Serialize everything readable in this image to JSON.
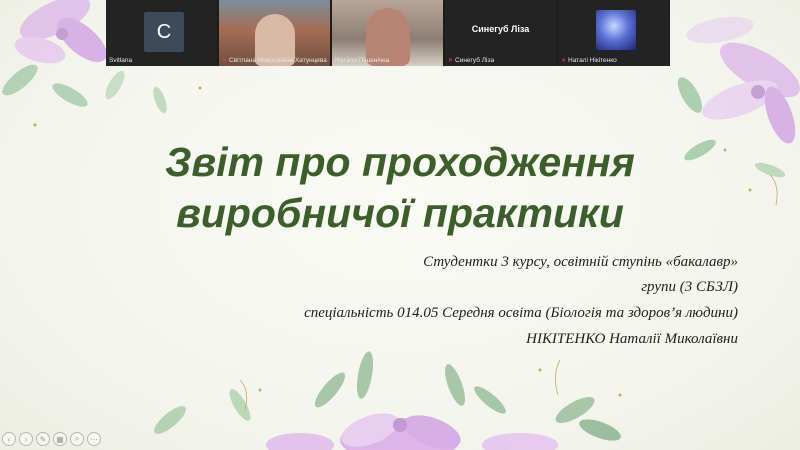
{
  "slide": {
    "title_line1": "Звіт про проходження",
    "title_line2": "виробничої практики",
    "subtitle_lines": [
      "Студентки 3 курсу, освітній ступінь «бакалавр»",
      "групи (3 СБЗЛ)",
      "спеціальність 014.05 Середня освіта (Біологія та здоров’я людини)",
      "НІКІТЕНКО Наталії Миколаївни"
    ],
    "colors": {
      "title": "#3c5e2a",
      "flower_pink": "#d9a6e8",
      "leaf_green": "#8fb892"
    }
  },
  "participants": [
    {
      "name": "Svitlana",
      "avatar_letter": "C",
      "type": "letter-avatar"
    },
    {
      "name": "Світлана Миколаївна Хатунцева",
      "type": "camera"
    },
    {
      "name": "Наталя Пішенічна",
      "type": "camera"
    },
    {
      "name": "Синегуб Ліза",
      "display_title": "Синегуб Ліза",
      "type": "name-only"
    },
    {
      "name": "Наталі Нікітенко",
      "type": "image-avatar"
    }
  ],
  "toolbar": {
    "icons": [
      "previous-icon",
      "next-icon",
      "pen-icon",
      "pages-icon",
      "zoom-icon",
      "more-icon"
    ],
    "glyphs": [
      "‹",
      "›",
      "✎",
      "▦",
      "⌕",
      "⋯"
    ]
  }
}
